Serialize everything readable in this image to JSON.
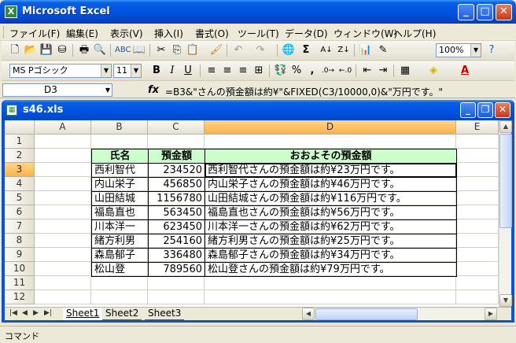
{
  "app": {
    "title": "Microsoft Excel",
    "logo": "X"
  },
  "menu": {
    "items": [
      "ファイル(F)",
      "編集(E)",
      "表示(V)",
      "挿入(I)",
      "書式(O)",
      "ツール(T)",
      "データ(D)",
      "ウィンドウ(W)",
      "ヘルプ(H)"
    ]
  },
  "toolbar": {
    "zoom": "100%",
    "font_name": "MS Pゴシック",
    "font_size": "11",
    "percent_label": "%",
    "comma_label": ","
  },
  "formula_bar": {
    "name_box": "D3",
    "fx_label": "fx",
    "formula": "=B3&\"さんの預金額は約¥\"&FIXED(C3/10000,0)&\"万円です。\""
  },
  "workbook": {
    "title": "s46.xls",
    "columns": [
      "A",
      "B",
      "C",
      "D",
      "E"
    ],
    "rows": [
      "1",
      "2",
      "3",
      "4",
      "5",
      "6",
      "7",
      "8",
      "9",
      "10",
      "11",
      "12"
    ],
    "active_cell": "D3",
    "table_headers": {
      "name": "氏名",
      "amount": "預金額",
      "summary": "おおよその預金額"
    },
    "records": [
      {
        "name": "西利智代",
        "amount": "234520",
        "summary": "西利智代さんの預金額は約¥23万円です。"
      },
      {
        "name": "内山栄子",
        "amount": "456850",
        "summary": "内山栄子さんの預金額は約¥46万円です。"
      },
      {
        "name": "山田結城",
        "amount": "1156780",
        "summary": "山田結城さんの預金額は約¥116万円です。"
      },
      {
        "name": "福島直也",
        "amount": "563450",
        "summary": "福島直也さんの預金額は約¥56万円です。"
      },
      {
        "name": "川本洋一",
        "amount": "623450",
        "summary": "川本洋一さんの預金額は約¥62万円です。"
      },
      {
        "name": "緒方利男",
        "amount": "254160",
        "summary": "緒方利男さんの預金額は約¥25万円です。"
      },
      {
        "name": "森島郁子",
        "amount": "336480",
        "summary": "森島郁子さんの預金額は約¥34万円です。"
      },
      {
        "name": "松山登",
        "amount": "789560",
        "summary": "松山登さんの預金額は約¥79万円です。"
      }
    ],
    "sheets": [
      "Sheet1",
      "Sheet2",
      "Sheet3"
    ],
    "active_sheet": "Sheet1"
  },
  "status": {
    "mode": "コマンド"
  },
  "colors": {
    "header_fill": "#ccffcc",
    "active_header": "#f8b346",
    "title_blue": "#0055e5"
  }
}
